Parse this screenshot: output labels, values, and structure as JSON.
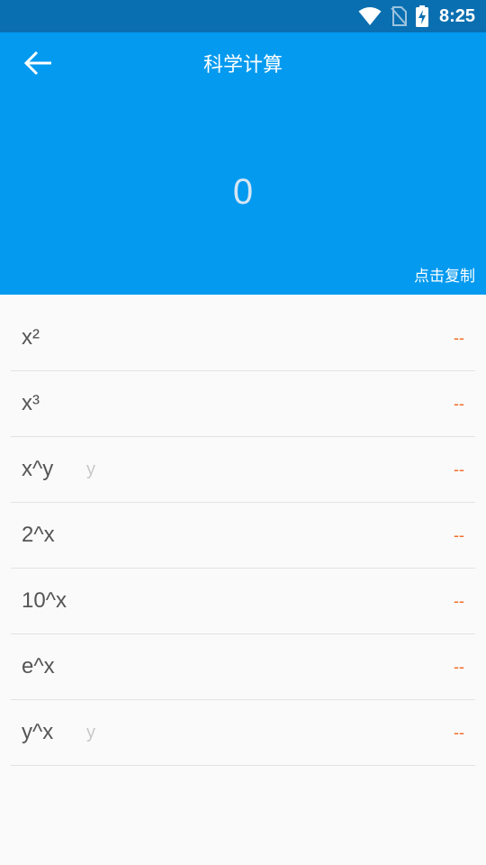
{
  "status": {
    "time": "8:25",
    "icons": [
      "wifi-icon",
      "no-sim-icon",
      "battery-charging-icon"
    ]
  },
  "header": {
    "title": "科学计算",
    "back_icon": "arrow-left-icon",
    "display_value": "0",
    "copy_label": "点击复制"
  },
  "colors": {
    "status_bar": "#0a6fb0",
    "header": "#039af0",
    "result": "#f36a21",
    "background": "#fafafa"
  },
  "functions": [
    {
      "label": "x²",
      "param": "",
      "result": "--"
    },
    {
      "label": "x³",
      "param": "",
      "result": "--"
    },
    {
      "label": "x^y",
      "param": "y",
      "result": "--"
    },
    {
      "label": "2^x",
      "param": "",
      "result": "--"
    },
    {
      "label": "10^x",
      "param": "",
      "result": "--"
    },
    {
      "label": "e^x",
      "param": "",
      "result": "--"
    },
    {
      "label": "y^x",
      "param": "y",
      "result": "--"
    }
  ]
}
